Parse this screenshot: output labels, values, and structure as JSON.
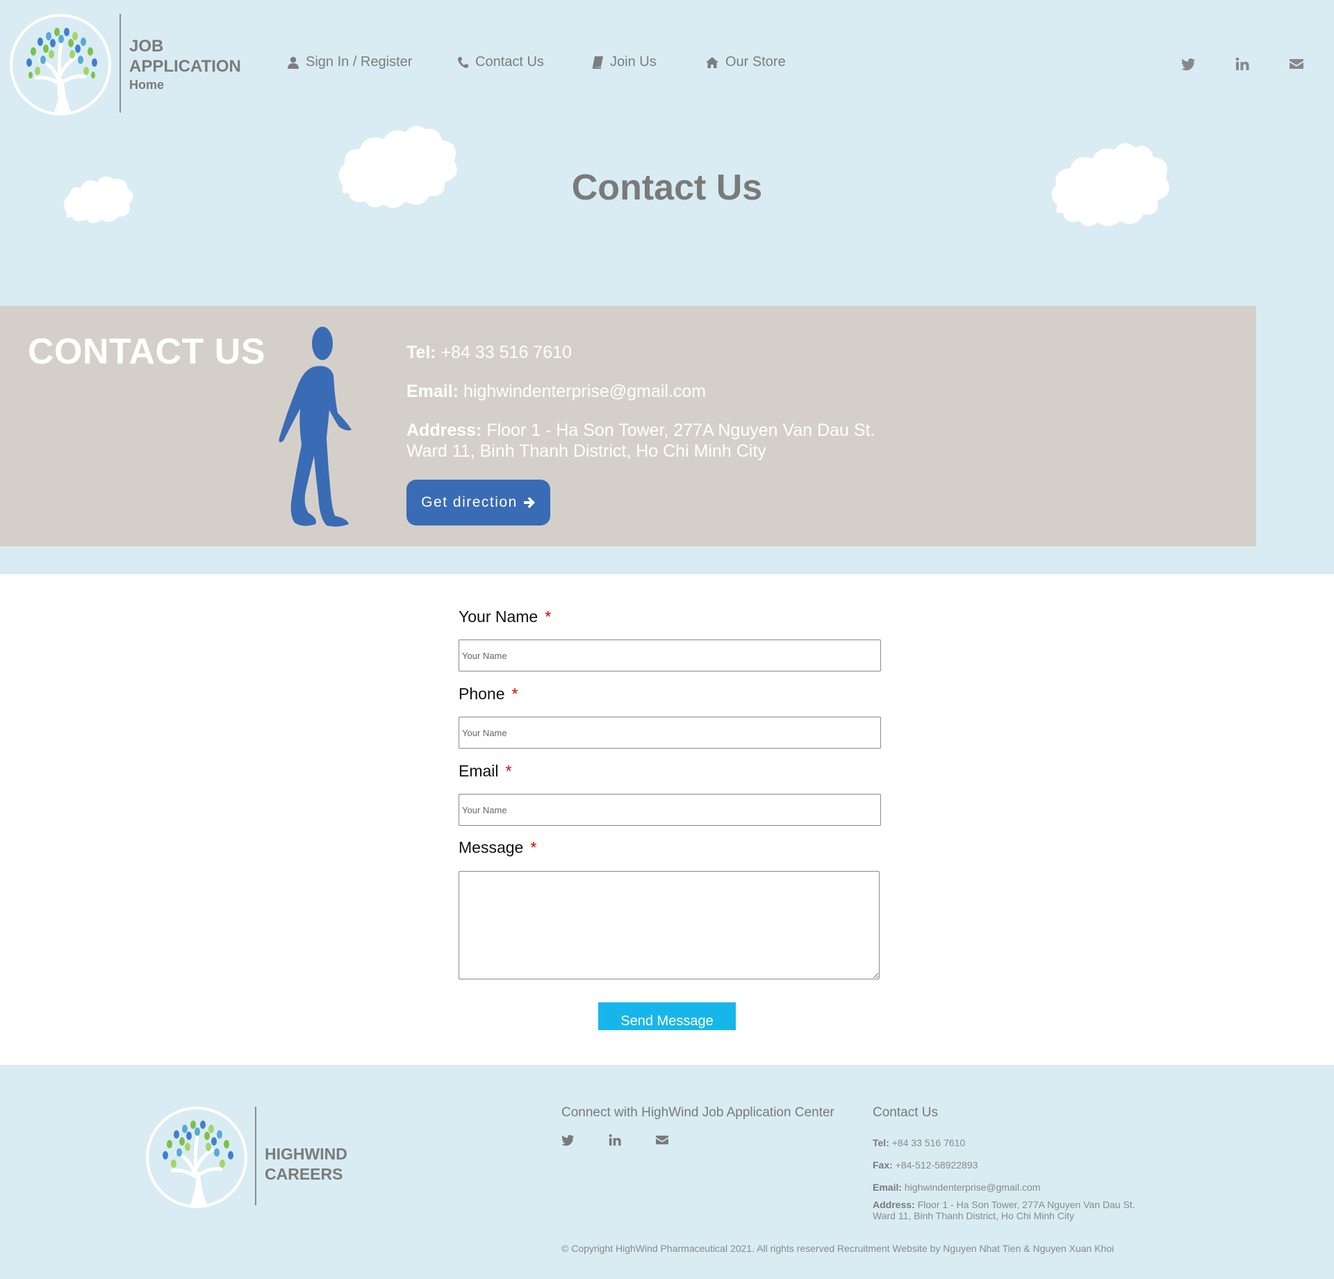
{
  "header": {
    "brand_line1": "JOB",
    "brand_line2": "APPLICATION",
    "brand_line3": "Home",
    "nav": [
      {
        "label": "Sign In / Register",
        "icon": "user-icon"
      },
      {
        "label": "Contact Us",
        "icon": "phone-icon"
      },
      {
        "label": "Join Us",
        "icon": "book-icon"
      },
      {
        "label": "Our Store",
        "icon": "home-icon"
      }
    ],
    "social": [
      "twitter-icon",
      "linkedin-icon",
      "envelope-icon"
    ]
  },
  "hero": {
    "title": "Contact Us"
  },
  "contact_band": {
    "title": "CONTACT US",
    "tel_label": "Tel:",
    "tel_value": "+84 33 516 7610",
    "email_label": "Email:",
    "email_value": "highwindenterprise@gmail.com",
    "address_label": "Address:",
    "address_line1": "Floor 1 - Ha Son Tower, 277A Nguyen Van Dau St.",
    "address_line2": "Ward 11, Binh Thanh District, Ho Chi Minh City",
    "direction_button": "Get direction"
  },
  "form": {
    "required_mark": "*",
    "name_label": "Your Name",
    "name_placeholder": "Your Name",
    "phone_label": "Phone",
    "phone_placeholder": "Your Name",
    "email_label": "Email",
    "email_placeholder": "Your Name",
    "message_label": "Message",
    "submit": "Send Message"
  },
  "footer": {
    "brand_line1": "HIGHWIND",
    "brand_line2": "CAREERS",
    "connect_title": "Connect with HighWind Job Application Center",
    "contact_title": "Contact Us",
    "tel_label": "Tel:",
    "tel_value": "+84 33 516 7610",
    "fax_label": "Fax:",
    "fax_value": "+84-512-58922893",
    "email_label": "Email:",
    "email_value": "highwindenterprise@gmail.com",
    "address_label": "Address:",
    "address_line1": "Floor 1 - Ha Son Tower, 277A Nguyen Van Dau St.",
    "address_line2": "Ward 11, Binh Thanh District, Ho Chi Minh City",
    "copyright": "© Copyright HighWind Pharmaceutical 2021. All rights reserved Recruitment Website by Nguyen Nhat Tien & Nguyen Xuan Khoi"
  },
  "colors": {
    "page_bg": "#d9ecf3",
    "band_bg": "#d4d0c9",
    "accent_blue": "#3a6bb5",
    "send_button": "#17b6ea",
    "required": "#dd0000"
  }
}
